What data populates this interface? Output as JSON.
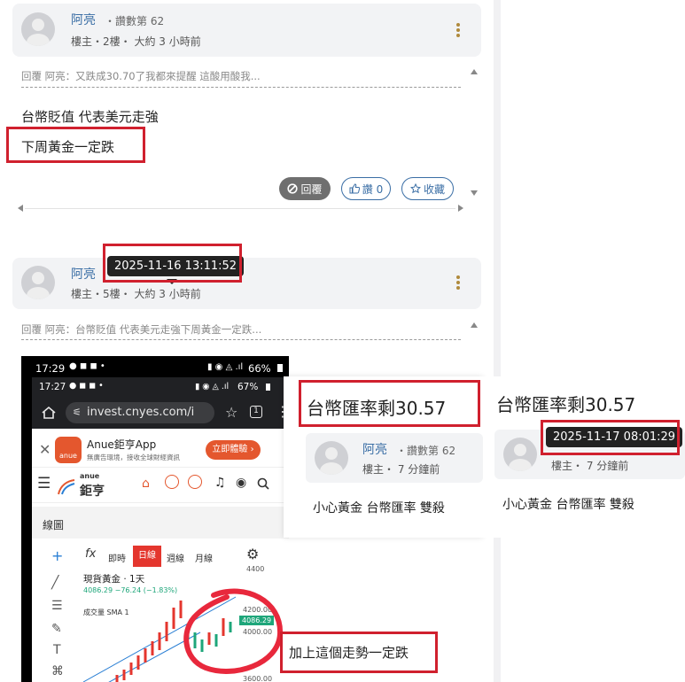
{
  "comment1": {
    "username": "阿亮",
    "fans": "・讚數第 62",
    "meta": "樓主・2樓・ 大約 3 小時前",
    "quote": "回覆 阿亮：又跌成30.70了我都來提醒 這酸用酸我...",
    "line1": "台幣貶值 代表美元走強",
    "line2": "下周黃金一定跌",
    "reply_label": "回覆",
    "like_label": "讚 0",
    "fav_label": "收藏"
  },
  "comment2": {
    "username": "阿亮",
    "meta": "樓主・5樓・ 大約 3 小時前",
    "quote": "回覆 阿亮：台幣貶值 代表美元走強下周黃金一定跌...",
    "tooltip": "2025-11-16 13:11:52"
  },
  "phone": {
    "outer_time": "17:29",
    "outer_battery": "66%",
    "inner_time": "17:27",
    "inner_battery": "67%",
    "url": "invest.cnyes.com/i",
    "tab_count": "1",
    "app_name": "Anue鉅亨App",
    "app_sub": "無廣告環境，接收全球財經資訊",
    "app_logo": "anue",
    "cta": "立即體驗",
    "site_brand_top": "anue",
    "site_brand": "鉅亨",
    "section": "線圖",
    "tabs": [
      "即時",
      "日線",
      "週線",
      "月線"
    ],
    "fx_label": "fx",
    "chart_title": "現貨黃金 · 1天",
    "chart_sub": "4086.29 −76.24 (−1.83%)",
    "chart_ind": "成交量 SMA 1",
    "y_labels": [
      "4200.00",
      "4086.29",
      "4000.00",
      "3600.00"
    ],
    "y_top": "4400"
  },
  "popup_left": {
    "title": "台幣匯率剩30.57",
    "username": "阿亮",
    "fans": "・讚數第 62",
    "meta": "樓主・ 7 分鐘前",
    "body": "小心黃金 台幣匯率 雙殺"
  },
  "popup_right": {
    "title": "台幣匯率剩30.57",
    "meta": "樓主・ 7 分鐘前",
    "body": "小心黃金 台幣匯率 雙殺",
    "tooltip": "2025-11-17 08:01:29"
  },
  "annotation": "加上這個走勢一定跌",
  "colors": {
    "highlight": "#d0202e",
    "link": "#3a6ea5",
    "panel": "#f2f3f5"
  }
}
